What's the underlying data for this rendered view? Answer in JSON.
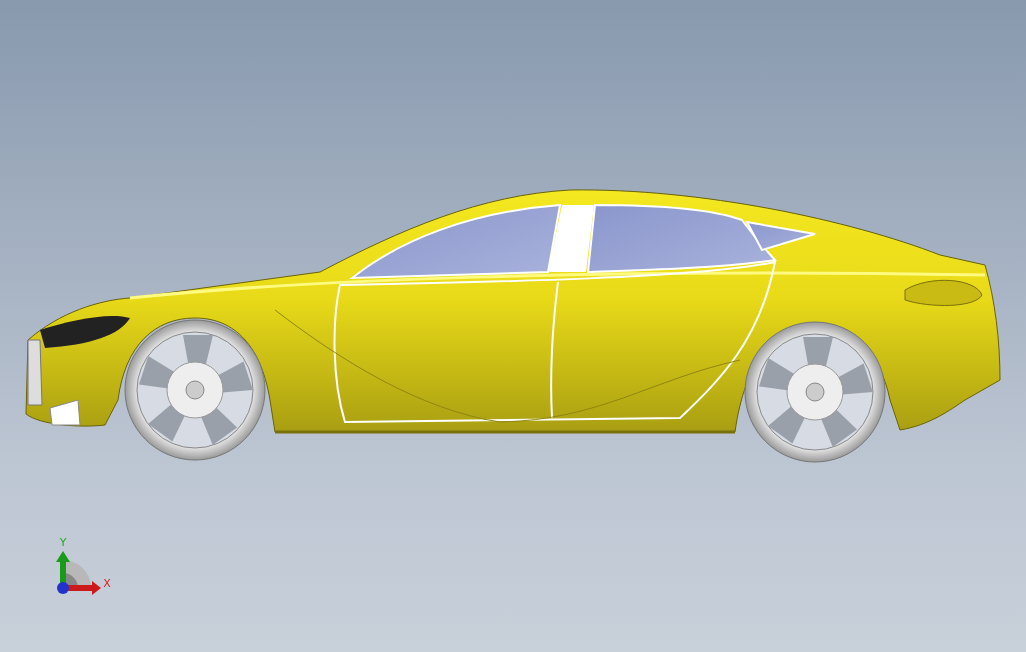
{
  "viewport": {
    "axis_triad": {
      "labels": [
        {
          "kind": "vertical",
          "text": "Y"
        },
        {
          "kind": "horizontal",
          "text": "X"
        }
      ]
    }
  }
}
